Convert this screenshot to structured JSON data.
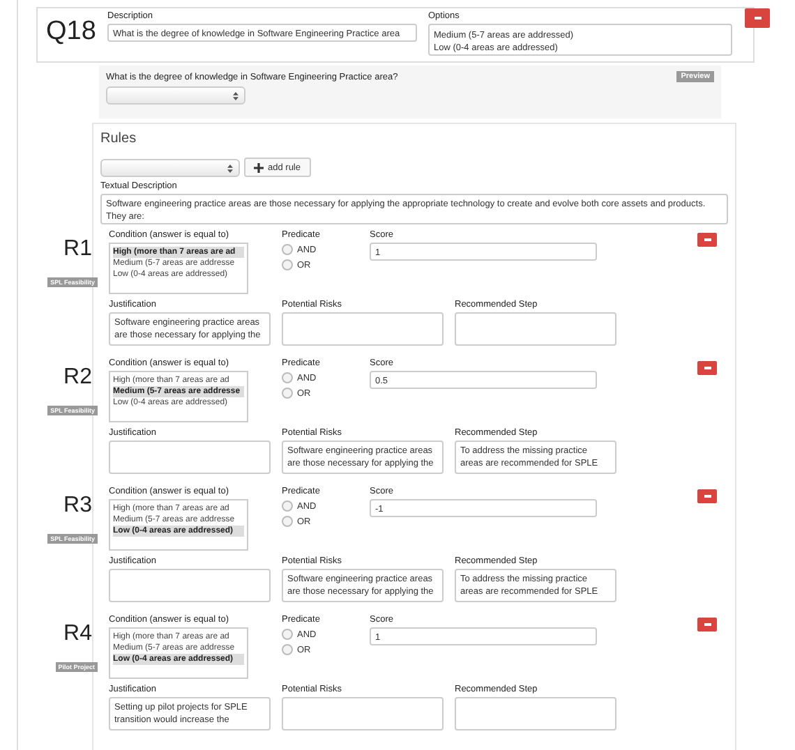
{
  "question": {
    "number": "Q18",
    "description_label": "Description",
    "description_value": "What is the degree of knowledge in Software Engineering Practice area",
    "options_label": "Options",
    "options_value": "Medium (5-7 areas are addressed)\nLow (0-4 areas are addressed)"
  },
  "preview": {
    "question_text": "What is the degree of knowledge in Software Engineering Practice area?",
    "button": "Preview"
  },
  "rules": {
    "title": "Rules",
    "add_button": "add rule",
    "textual_label": "Textual Description",
    "textual_value": "Software engineering practice areas are those necessary for applying the appropriate technology to create and evolve both core assets and products. They are:",
    "items": [
      {
        "number": "R1",
        "tag": "SPL Feasibility",
        "condition_label": "Condition (answer is equal to)",
        "options": [
          {
            "text": "High (more than 7 areas are ad",
            "selected": true
          },
          {
            "text": "Medium (5-7 areas are addresse",
            "selected": false
          },
          {
            "text": "Low (0-4 areas are addressed)",
            "selected": false
          }
        ],
        "predicate_label": "Predicate",
        "predicates": [
          {
            "label": "AND",
            "checked": false
          },
          {
            "label": "OR",
            "checked": false
          }
        ],
        "score_label": "Score",
        "score": "1",
        "justification_label": "Justification",
        "justification": "Software engineering practice areas are those necessary for applying the",
        "risks_label": "Potential Risks",
        "step_label": "Recommended Step"
      },
      {
        "number": "R2",
        "tag": "SPL Feasibility",
        "condition_label": "Condition (answer is equal to)",
        "options": [
          {
            "text": "High (more than 7 areas are ad",
            "selected": false
          },
          {
            "text": "Medium (5-7 areas are addresse",
            "selected": true
          },
          {
            "text": "Low (0-4 areas are addressed)",
            "selected": false
          }
        ],
        "predicate_label": "Predicate",
        "predicates": [
          {
            "label": "AND",
            "checked": false
          },
          {
            "label": "OR",
            "checked": false
          }
        ],
        "score_label": "Score",
        "score": "0.5",
        "justification_label": "Justification",
        "risks_label": "Potential Risks",
        "risks": "Software engineering practice areas are those necessary for applying the",
        "step_label": "Recommended Step",
        "step": "To address the missing practice areas are recommended for SPLE"
      },
      {
        "number": "R3",
        "tag": "SPL Feasibility",
        "condition_label": "Condition (answer is equal to)",
        "options": [
          {
            "text": "High (more than 7 areas are ad",
            "selected": false
          },
          {
            "text": "Medium (5-7 areas are addresse",
            "selected": false
          },
          {
            "text": "Low (0-4 areas are addressed)",
            "selected": true
          }
        ],
        "predicate_label": "Predicate",
        "predicates": [
          {
            "label": "AND",
            "checked": false
          },
          {
            "label": "OR",
            "checked": false
          }
        ],
        "score_label": "Score",
        "score": "-1",
        "justification_label": "Justification",
        "risks_label": "Potential Risks",
        "risks": "Software engineering practice areas are those necessary for applying the",
        "step_label": "Recommended Step",
        "step": "To address the missing practice areas are recommended for SPLE"
      },
      {
        "number": "R4",
        "tag": "Pilot Project",
        "condition_label": "Condition (answer is equal to)",
        "options": [
          {
            "text": "High (more than 7 areas are ad",
            "selected": false
          },
          {
            "text": "Medium (5-7 areas are addresse",
            "selected": false
          },
          {
            "text": "Low (0-4 areas are addressed)",
            "selected": true
          }
        ],
        "predicate_label": "Predicate",
        "predicates": [
          {
            "label": "AND",
            "checked": false
          },
          {
            "label": "OR",
            "checked": false
          }
        ],
        "score_label": "Score",
        "score": "1",
        "justification_label": "Justification",
        "justification": "Setting up pilot projects for SPLE transition would increase the",
        "risks_label": "Potential Risks",
        "step_label": "Recommended Step"
      }
    ]
  }
}
